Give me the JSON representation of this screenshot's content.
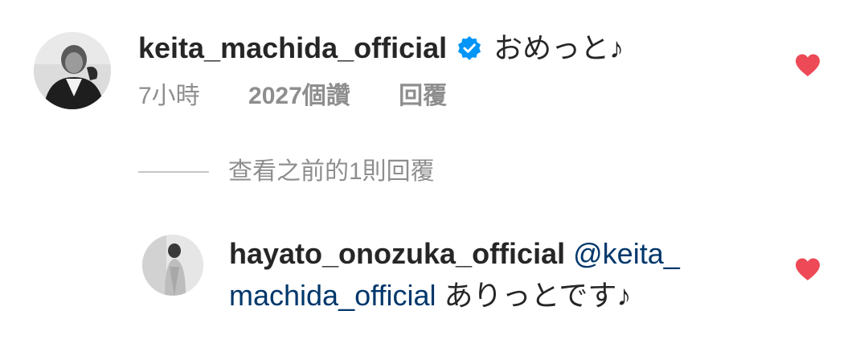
{
  "comment": {
    "username": "keita_machida_official",
    "verified": true,
    "text": "おめっと♪",
    "time": "7小時",
    "likes": "2027個讚",
    "reply_label": "回覆",
    "liked": true,
    "heart_color": "#ed4956"
  },
  "view_replies": {
    "label": "查看之前的1則回覆"
  },
  "reply": {
    "username": "hayato_onozuka_official",
    "mention": "@keita_machida_official",
    "text": "ありっとです♪",
    "liked": true,
    "heart_color": "#ed4956"
  },
  "colors": {
    "verified_badge": "#0095f6",
    "mention": "#00376b",
    "secondary_text": "#8e8e8e"
  },
  "icons": {
    "verified": "verified-badge-icon",
    "like": "heart-icon"
  }
}
